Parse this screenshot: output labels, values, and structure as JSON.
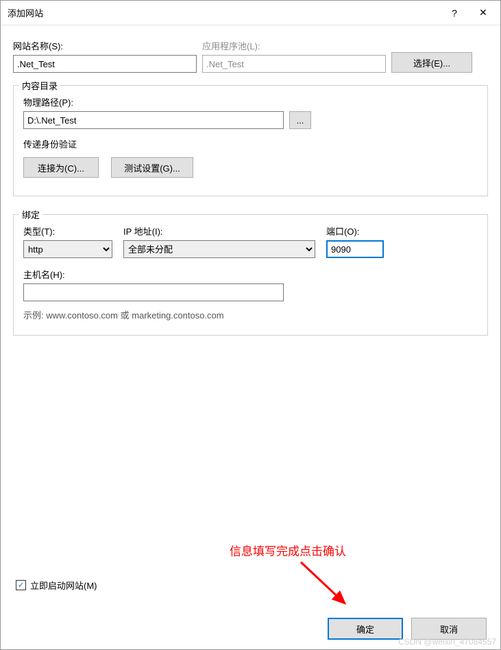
{
  "titlebar": {
    "title": "添加网站",
    "help": "?",
    "close": "✕"
  },
  "site_name_label": "网站名称(S):",
  "site_name_value": ".Net_Test",
  "app_pool_label": "应用程序池(L):",
  "app_pool_value": ".Net_Test",
  "select_btn": "选择(E)...",
  "content_dir": {
    "legend": "内容目录",
    "path_label": "物理路径(P):",
    "path_value": "D:\\.Net_Test",
    "browse": "...",
    "auth_label": "传递身份验证",
    "connect_as": "连接为(C)...",
    "test_settings": "测试设置(G)..."
  },
  "binding": {
    "legend": "绑定",
    "type_label": "类型(T):",
    "type_value": "http",
    "ip_label": "IP 地址(I):",
    "ip_value": "全部未分配",
    "port_label": "端口(O):",
    "port_value": "9090",
    "host_label": "主机名(H):",
    "host_value": "",
    "example": "示例: www.contoso.com 或 marketing.contoso.com"
  },
  "start_immediately": "立即启动网站(M)",
  "checkmark": "✓",
  "ok": "确定",
  "cancel": "取消",
  "annotation_text": "信息填写完成点击确认",
  "watermark": "CSDN @weixin_47084557"
}
